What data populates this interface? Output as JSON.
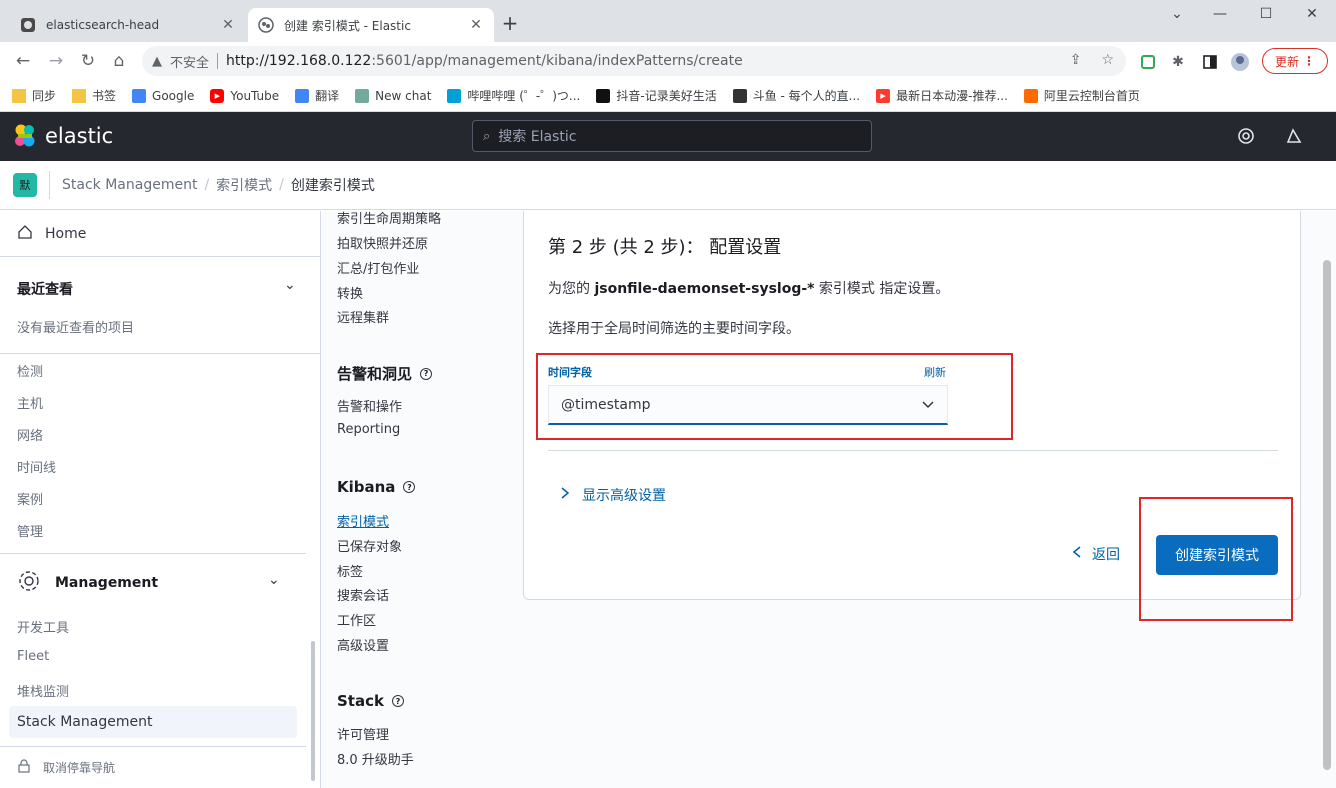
{
  "browser": {
    "tabs": [
      {
        "title": "elasticsearch-head",
        "active": false
      },
      {
        "title": "创建 索引模式 - Elastic",
        "active": true
      }
    ],
    "address": {
      "insecure_label": "不安全",
      "url_host": "http://192.168.0.122",
      "url_rest": ":5601/app/management/kibana/indexPatterns/create"
    },
    "update_label": "更新",
    "bookmarks": [
      {
        "label": "同步",
        "icon": "folder-icon",
        "color": "#f4c542"
      },
      {
        "label": "书签",
        "icon": "folder-icon",
        "color": "#f4c542"
      },
      {
        "label": "Google",
        "icon": "google-icon",
        "color": "#4285f4"
      },
      {
        "label": "YouTube",
        "icon": "youtube-icon",
        "color": "#ff0000"
      },
      {
        "label": "翻译",
        "icon": "translate-icon",
        "color": "#4285f4"
      },
      {
        "label": "New chat",
        "icon": "openai-icon",
        "color": "#74aa9c"
      },
      {
        "label": "哔哩哔哩 (゜-゜)つ...",
        "icon": "bilibili-icon",
        "color": "#00a1d6"
      },
      {
        "label": "抖音-记录美好生活",
        "icon": "tiktok-icon",
        "color": "#111111"
      },
      {
        "label": "斗鱼 - 每个人的直...",
        "icon": "douyu-icon",
        "color": "#333333"
      },
      {
        "label": "最新日本动漫-推荐...",
        "icon": "play-icon",
        "color": "#ff3b30"
      },
      {
        "label": "阿里云控制台首页",
        "icon": "aliyun-icon",
        "color": "#ff6a00"
      }
    ]
  },
  "kibana": {
    "brand": "elastic",
    "search_placeholder": "搜索 Elastic",
    "space_badge": "默",
    "breadcrumbs": [
      "Stack Management",
      "索引模式",
      "创建索引模式"
    ]
  },
  "leftnav": {
    "home": "Home",
    "recent_header": "最近查看",
    "recent_empty": "没有最近查看的项目",
    "security_items": [
      "检测",
      "主机",
      "网络",
      "时间线",
      "案例",
      "管理"
    ],
    "management_header": "Management",
    "management_items": [
      "开发工具",
      "Fleet",
      "堆栈监测",
      "Stack Management"
    ],
    "undock": "取消停靠导航"
  },
  "mgmtnav": {
    "data_items": [
      "索引生命周期策略",
      "拍取快照并还原",
      "汇总/打包作业",
      "转换",
      "远程集群"
    ],
    "alerts_header": "告警和洞见",
    "alerts_items": [
      "告警和操作",
      "Reporting"
    ],
    "kibana_header": "Kibana",
    "kibana_items": [
      "索引模式",
      "已保存对象",
      "标签",
      "搜索会话",
      "工作区",
      "高级设置"
    ],
    "stack_header": "Stack",
    "stack_items": [
      "许可管理",
      "8.0 升级助手"
    ]
  },
  "main": {
    "step_title": "第 2 步 (共 2 步)： 配置设置",
    "desc_prefix": "为您的 ",
    "pattern_name": "jsonfile-daemonset-syslog-*",
    "desc_suffix": " 索引模式 指定设置。",
    "desc2": "选择用于全局时间筛选的主要时间字段。",
    "time_field_label": "时间字段",
    "refresh_label": "刷新",
    "time_field_value": "@timestamp",
    "advanced_toggle": "显示高级设置",
    "back_label": "返回",
    "create_label": "创建索引模式"
  },
  "colors": {
    "accent": "#0061a6",
    "primary_button": "#0a6cbf",
    "header_bg": "#25282f",
    "annotation_red": "#e0262b"
  }
}
